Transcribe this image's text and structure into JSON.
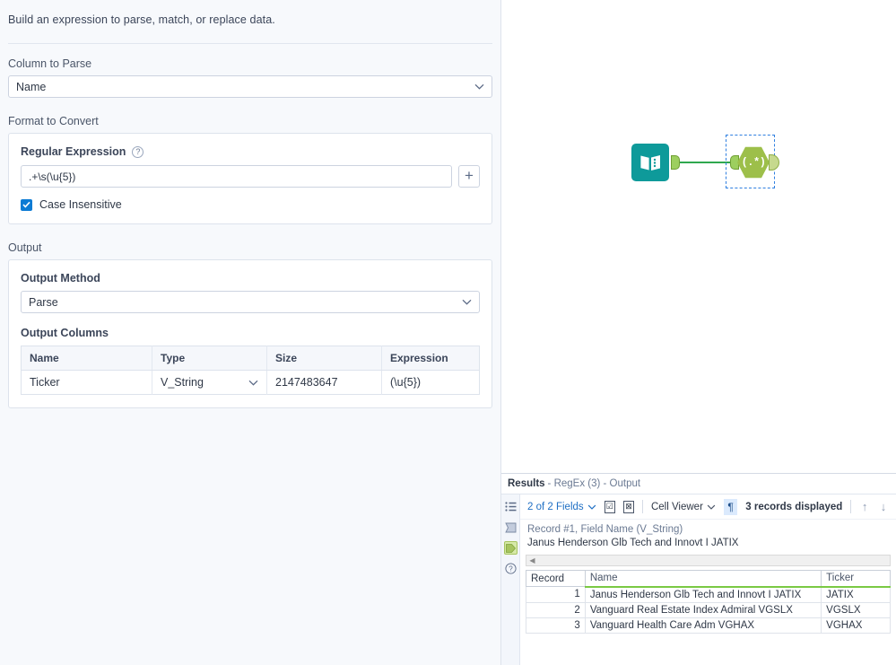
{
  "config": {
    "intro": "Build an expression to parse, match, or replace data.",
    "column_to_parse": {
      "label": "Column to Parse",
      "value": "Name"
    },
    "format_to_convert": {
      "label": "Format to Convert",
      "regex_label": "Regular Expression",
      "regex_value": ".+\\s(\\u{5})",
      "help_glyph": "?",
      "add_button_glyph": "+",
      "case_insensitive_label": "Case Insensitive",
      "case_insensitive_checked": true
    },
    "output": {
      "label": "Output",
      "method_label": "Output Method",
      "method_value": "Parse",
      "columns_label": "Output Columns",
      "headers": [
        "Name",
        "Type",
        "Size",
        "Expression"
      ],
      "rows": [
        {
          "name": "Ticker",
          "type": "V_String",
          "size": "2147483647",
          "expression": "(\\u{5})"
        }
      ]
    }
  },
  "canvas": {
    "input_tool_name": "input-data-tool",
    "regex_tool_name": "regex-tool",
    "regex_tool_glyph": "(.*)",
    "selected": true
  },
  "results": {
    "title_bold": "Results",
    "title_sub": "- RegEx (3) - Output",
    "rail": [
      "list-icon",
      "metadata-icon",
      "output-anchor-icon",
      "help-icon"
    ],
    "toolbar": {
      "fields_label": "2 of 2 Fields",
      "select_all_glyph": "☑",
      "deselect_all_glyph": "⊠",
      "viewer_label": "Cell Viewer",
      "pilcrow_glyph": "¶",
      "records_label": "3 records displayed",
      "up_glyph": "↑",
      "down_glyph": "↓"
    },
    "cell_viewer": {
      "header": "Record #1, Field Name (V_String)",
      "value": "Janus Henderson Glb Tech and Innovt I JATIX"
    },
    "grid": {
      "headers": [
        "Record",
        "Name",
        "Ticker"
      ],
      "rows": [
        {
          "record": "1",
          "name": "Janus Henderson Glb Tech and Innovt I JATIX",
          "ticker": "JATIX"
        },
        {
          "record": "2",
          "name": "Vanguard Real Estate Index Admiral VGSLX",
          "ticker": "VGSLX"
        },
        {
          "record": "3",
          "name": "Vanguard Health Care Adm VGHAX",
          "ticker": "VGHAX"
        }
      ]
    }
  },
  "colors": {
    "accent_blue": "#1f6fc4",
    "teal_tool": "#0e9a9a",
    "green_tool": "#9dbf4a",
    "green_connector": "#2fa84f",
    "checkbox_blue": "#0c7bd4",
    "panel_bg": "#f7f9fc"
  }
}
